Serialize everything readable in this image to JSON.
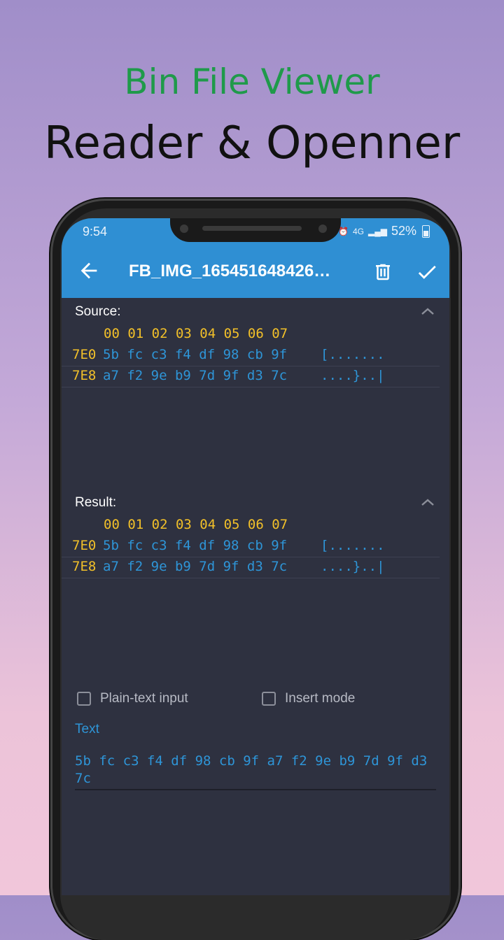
{
  "promo": {
    "title": "Bin File Viewer",
    "subtitle": "Reader & Openner"
  },
  "status_bar": {
    "time": "9:54",
    "network": "4G",
    "battery": "52%"
  },
  "app_bar": {
    "title": "FB_IMG_165451648426…",
    "icons": [
      "arrow-back-icon",
      "trash-icon",
      "check-icon"
    ]
  },
  "source": {
    "label": "Source:",
    "header": "00 01 02 03 04 05 06 07",
    "rows": [
      {
        "addr": "7E0",
        "bytes": "5b fc c3 f4 df 98 cb 9f",
        "ascii": "[......."
      },
      {
        "addr": "7E8",
        "bytes": "a7 f2 9e b9 7d 9f d3 7c",
        "ascii": "....}..|"
      }
    ]
  },
  "result": {
    "label": "Result:",
    "header": "00 01 02 03 04 05 06 07",
    "rows": [
      {
        "addr": "7E0",
        "bytes": "5b fc c3 f4 df 98 cb 9f",
        "ascii": "[......."
      },
      {
        "addr": "7E8",
        "bytes": "a7 f2 9e b9 7d 9f d3 7c",
        "ascii": "....}..|"
      }
    ]
  },
  "options": {
    "plain_text_label": "Plain-text input",
    "insert_mode_label": "Insert mode"
  },
  "text_field": {
    "label": "Text",
    "value": "5b fc c3 f4 df 98 cb 9f a7 f2 9e b9 7d 9f d3 7c"
  },
  "colors": {
    "accent": "#2f8fd3",
    "hex_address": "#f2c029",
    "hex_value": "#2e95d7",
    "promo_title": "#1f9a4a"
  }
}
